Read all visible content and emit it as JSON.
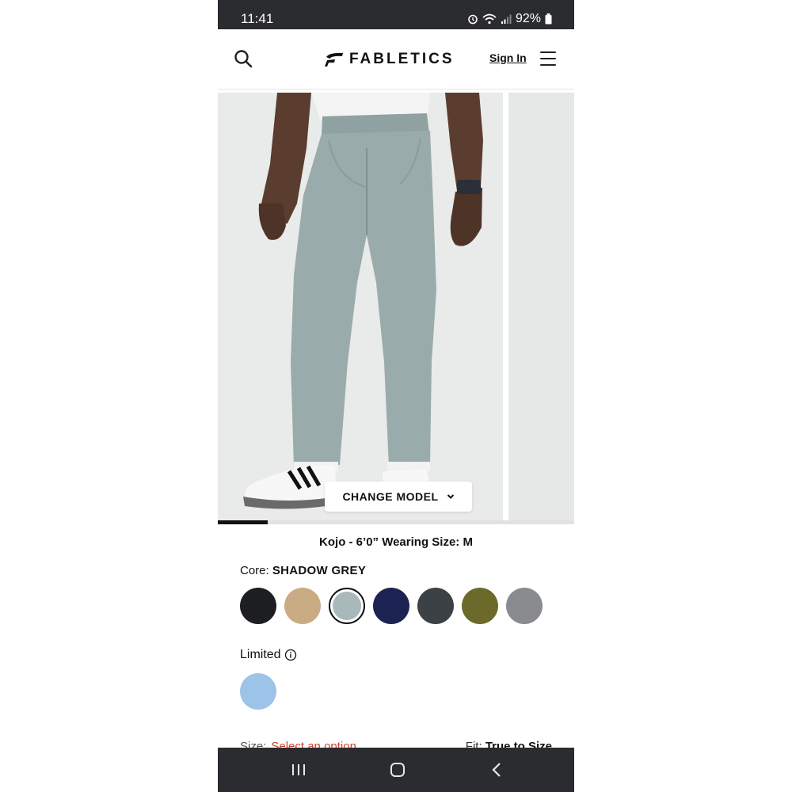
{
  "status_bar": {
    "time": "11:41",
    "battery": "92%"
  },
  "header": {
    "brand": "FABLETICS",
    "sign_in": "Sign In",
    "icons": [
      "search-icon",
      "brand-logo-icon",
      "hamburger-menu-icon"
    ]
  },
  "gallery": {
    "change_model_label": "CHANGE MODEL",
    "image_progress_fraction": 0.14
  },
  "model_info": "Kojo - 6’0” Wearing Size: M",
  "colors": {
    "core_label": "Core:",
    "core_selected": "SHADOW GREY",
    "core_swatches": [
      {
        "name": "black",
        "hex": "#1d1e21"
      },
      {
        "name": "khaki",
        "hex": "#c9ab84"
      },
      {
        "name": "shadow-grey",
        "hex": "#a9b8ba",
        "selected": true
      },
      {
        "name": "navy",
        "hex": "#1c2352"
      },
      {
        "name": "charcoal",
        "hex": "#3c4146"
      },
      {
        "name": "olive",
        "hex": "#6c6a2a"
      },
      {
        "name": "heather-grey",
        "hex": "#8a8b8e"
      }
    ],
    "limited_label": "Limited",
    "limited_swatches": [
      {
        "name": "light-blue",
        "hex": "#9cc3e8"
      }
    ]
  },
  "size": {
    "label": "Size:",
    "prompt": "Select an option"
  },
  "fit": {
    "label": "Fit:",
    "value": "True to Size"
  },
  "nav_bar": {
    "icons": [
      "recent-apps-icon",
      "home-icon",
      "back-icon"
    ]
  }
}
